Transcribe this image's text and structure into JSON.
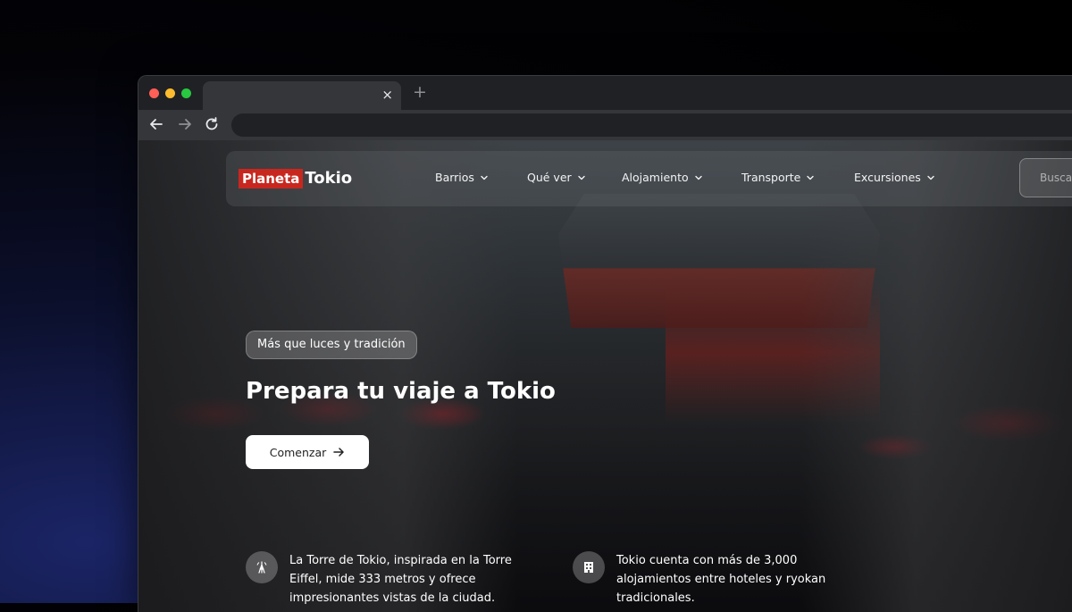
{
  "browser": {
    "tab": {
      "title": "",
      "close_glyph": "×"
    },
    "new_tab_glyph": "+",
    "address": ""
  },
  "site": {
    "logo": {
      "part1": "Planeta",
      "part2": "Tokio",
      "part1_bg": "#c8271f"
    },
    "nav": [
      {
        "label": "Barrios"
      },
      {
        "label": "Qué ver"
      },
      {
        "label": "Alojamiento"
      },
      {
        "label": "Transporte"
      },
      {
        "label": "Excursiones"
      }
    ],
    "search_placeholder": "Buscar"
  },
  "hero": {
    "badge": "Más que luces y tradición",
    "title": "Prepara tu viaje a Tokio",
    "cta_label": "Comenzar",
    "cta_icon": "arrow-right-icon",
    "facts": [
      {
        "icon": "tower-icon",
        "text": "La Torre de Tokio, inspirada en la Torre Eiffel, mide 333 metros y ofrece impresionantes vistas de la ciudad."
      },
      {
        "icon": "hotel-icon",
        "text": "Tokio cuenta con más de 3,000 alojamientos entre hoteles y ryokan tradicionales."
      }
    ]
  }
}
